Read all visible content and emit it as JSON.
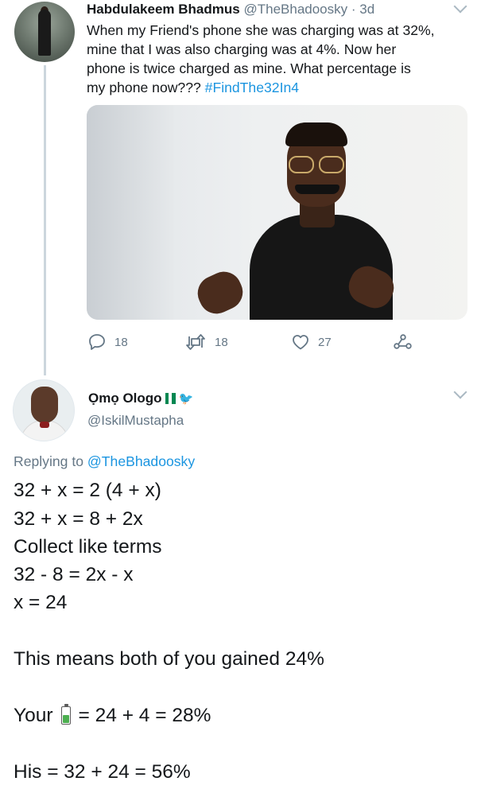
{
  "tweet1": {
    "display_name": "Habdulakeem Bhadmus",
    "handle_time": "@TheBhadoosky · 3d",
    "text_lines": [
      "When my Friend's phone she was charging was at 32%,",
      "mine that I was also charging was at 4%. Now her",
      "phone is twice charged as mine. What percentage is",
      "my phone now??? "
    ],
    "hashtag": "#FindThe32In4",
    "actions": {
      "replies": "18",
      "retweets": "18",
      "likes": "27"
    }
  },
  "tweet2": {
    "display_name": "Ọmọ Ologo",
    "handle": "@IskilMustapha",
    "replying_prefix": "Replying to ",
    "replying_to": "@TheBhadoosky",
    "lines": [
      "32 + x = 2 (4 + x)",
      "32 + x = 8 + 2x",
      "Collect like terms",
      "32 - 8 = 2x - x",
      "x = 24",
      "This means both of you gained 24%",
      "Your",
      "= 24 + 4 = 28%",
      "His = 32 + 24 = 56%"
    ]
  },
  "colors": {
    "link": "#1b95e0",
    "secondary_text": "#657786",
    "flag_green": "#008751",
    "battery_green": "#4caf50"
  },
  "icons": [
    "reply-icon",
    "retweet-icon",
    "like-icon",
    "share-icon",
    "chevron-down-icon",
    "nigeria-flag-icon",
    "bird-icon",
    "battery-icon"
  ]
}
